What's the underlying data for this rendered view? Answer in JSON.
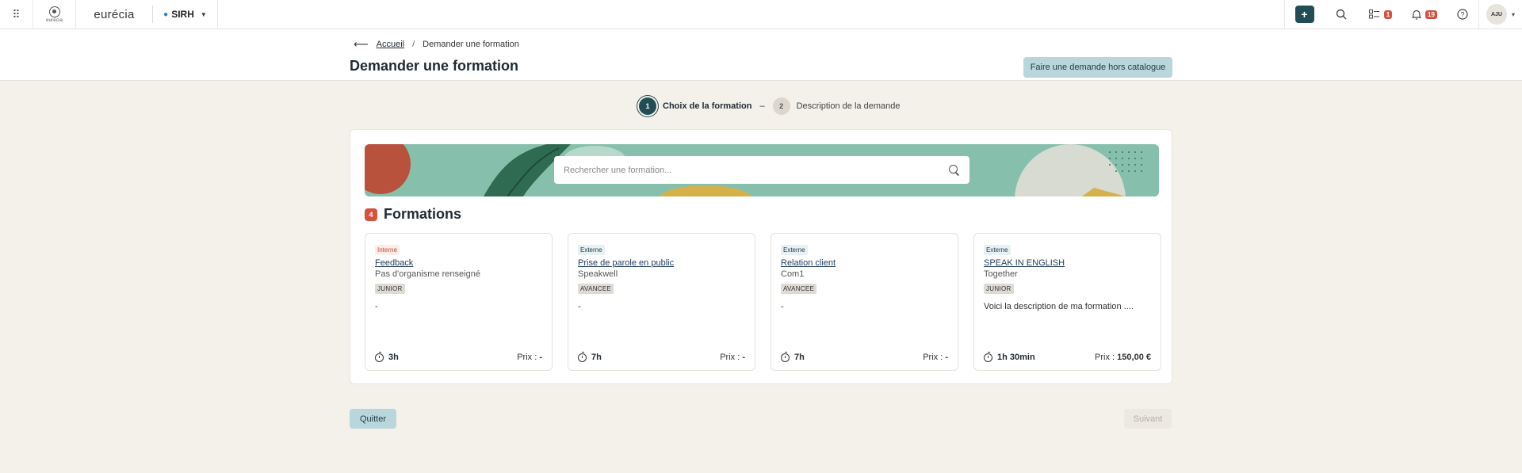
{
  "topbar": {
    "apps_icon": "grid-icon",
    "brand_logo_text": "eurécia",
    "brand_name": "eurécia",
    "module": "SIRH",
    "todo_count": "1",
    "notif_count": "19",
    "avatar_initials": "AJU"
  },
  "breadcrumb": {
    "home": "Accueil",
    "current": "Demander une formation"
  },
  "page": {
    "title": "Demander une formation",
    "hors_catalogue": "Faire une demande hors catalogue"
  },
  "stepper": {
    "step1_num": "1",
    "step1_label": "Choix de la formation",
    "dash": "–",
    "step2_num": "2",
    "step2_label": "Description de la demande"
  },
  "search": {
    "placeholder": "Rechercher une formation..."
  },
  "formations": {
    "count": "4",
    "title": "Formations",
    "price_label": "Prix :",
    "items": [
      {
        "type": "Interne",
        "title": "Feedback",
        "org": "Pas d'organisme renseigné",
        "level": "JUNIOR",
        "desc": "-",
        "duration": "3h",
        "price": "-"
      },
      {
        "type": "Externe",
        "title": "Prise de parole en public",
        "org": "Speakwell",
        "level": "AVANCEE",
        "desc": "-",
        "duration": "7h",
        "price": "-"
      },
      {
        "type": "Externe",
        "title": "Relation client",
        "org": "Com1",
        "level": "AVANCEE",
        "desc": "-",
        "duration": "7h",
        "price": "-"
      },
      {
        "type": "Externe",
        "title": "SPEAK IN ENGLISH",
        "org": "Together",
        "level": "JUNIOR",
        "desc": "Voici la description de ma formation ....",
        "duration": "1h 30min",
        "price": "150,00 €"
      }
    ]
  },
  "footer": {
    "quit": "Quitter",
    "next": "Suivant"
  },
  "colors": {
    "primary_dark": "#214d54",
    "accent_light": "#b9d6dc",
    "badge_red": "#d4533f",
    "page_bg": "#f4f0ea"
  }
}
